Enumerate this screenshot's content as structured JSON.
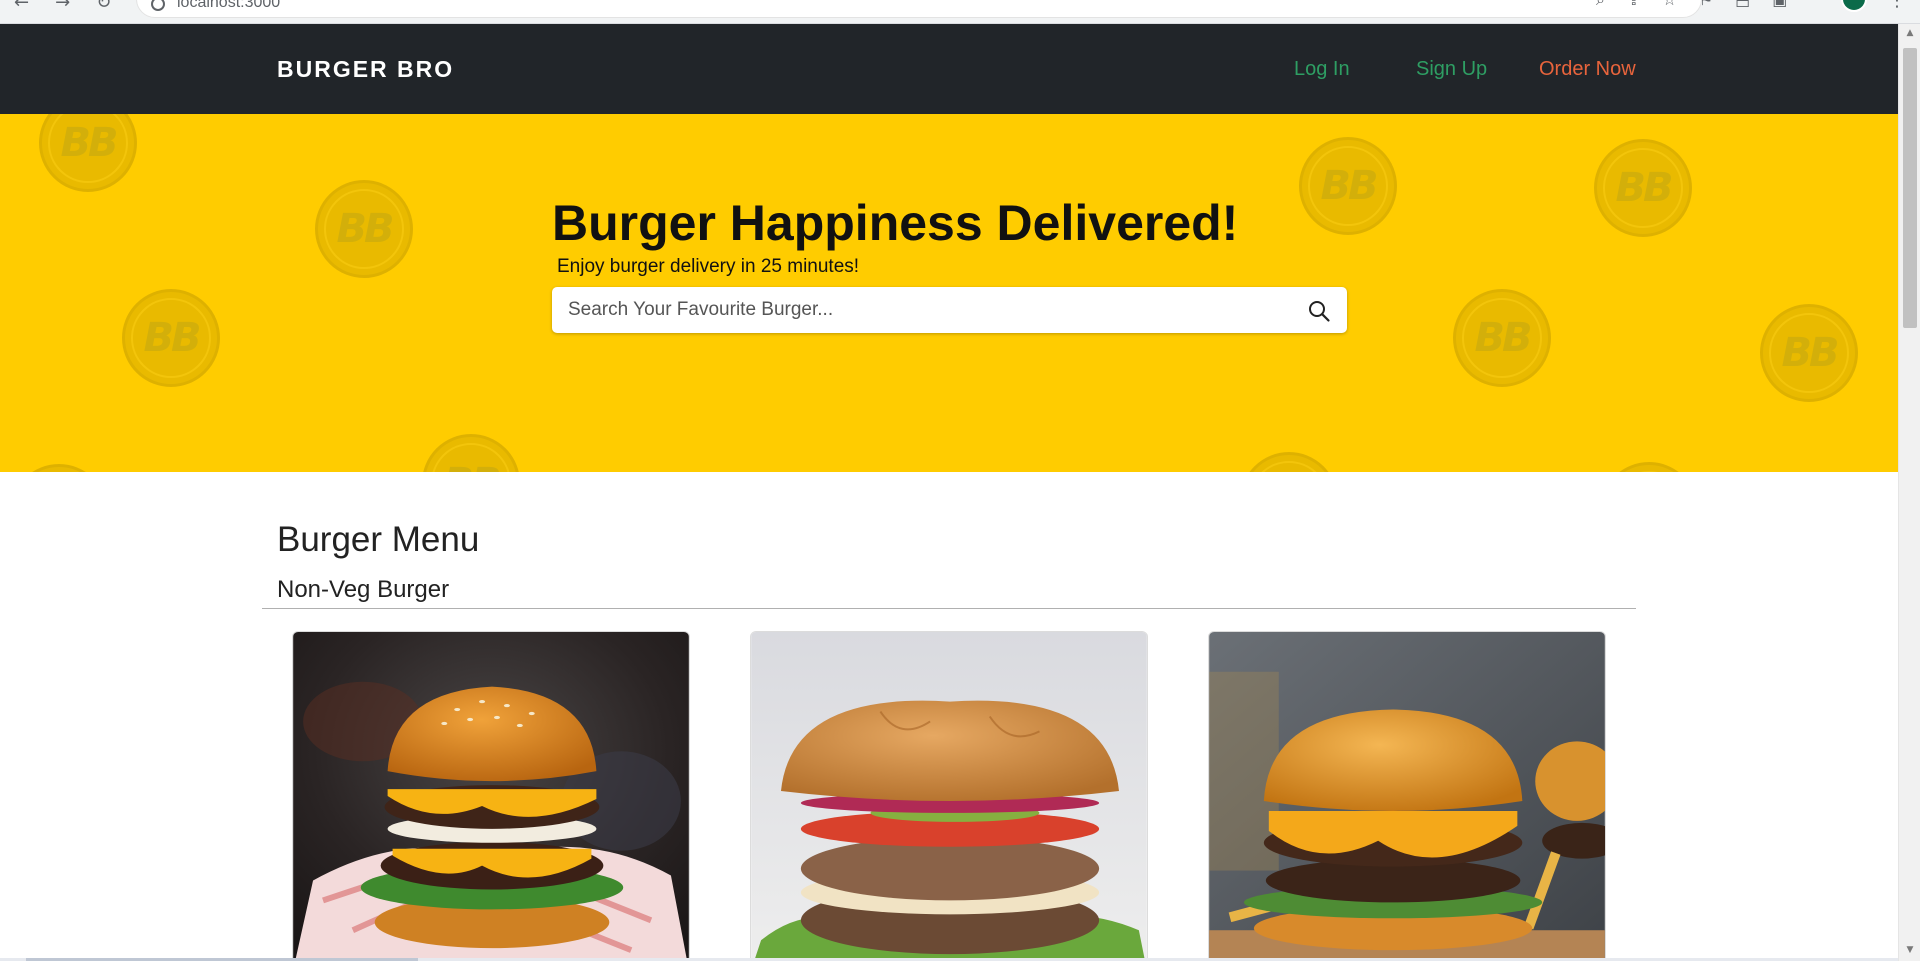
{
  "browser": {
    "url": "localhost:3000",
    "nav_glyphs": [
      "←",
      "→",
      "↻"
    ],
    "tool_glyphs": [
      "⌕",
      "⇪",
      "☆",
      "⚑",
      "⬒",
      "▣"
    ],
    "menu_glyph": "⋮"
  },
  "navbar": {
    "brand": "BURGER BRO",
    "links": {
      "login": "Log In",
      "signup": "Sign Up",
      "order": "Order Now"
    },
    "colors": {
      "background": "#212529",
      "auth_links": "#2e9e63",
      "order_link": "#e8643c"
    }
  },
  "hero": {
    "title": "Burger Happiness Delivered!",
    "subtitle": "Enjoy burger delivery in 25 minutes!",
    "search_placeholder": "Search Your Favourite Burger...",
    "search_icon": "search-icon",
    "background_color": "#ffcc00",
    "watermark_text": "BB"
  },
  "menu": {
    "title": "Burger Menu",
    "category": "Non-Veg Burger",
    "cards": [
      {
        "image": "burger-double-patty-on-paper-image"
      },
      {
        "image": "burger-chicken-lettuce-tomato-image"
      },
      {
        "image": "burger-double-cheese-with-fries-image"
      }
    ]
  }
}
